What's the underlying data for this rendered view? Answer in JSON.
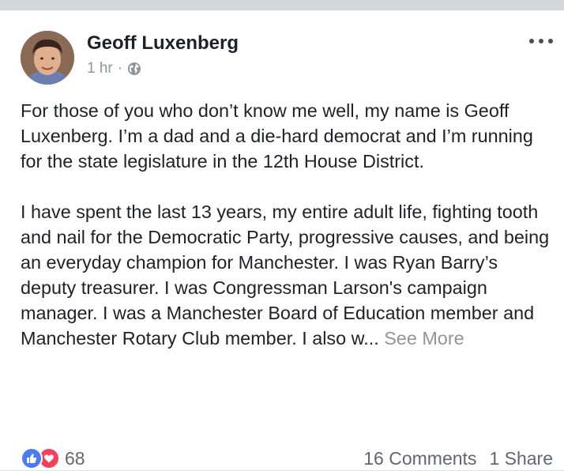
{
  "post": {
    "author": "Geoff Luxenberg",
    "time": "1 hr",
    "meta_separator": "·",
    "privacy_icon": "globe-icon",
    "paragraphs": [
      "For those of you who don’t know me well, my name is Geoff Luxenberg. I’m a dad and a die-hard democrat and I’m running for the state legislature in the 12th House District.",
      "I have spent the last 13 years, my entire adult life, fighting tooth and nail for the Democratic Party, progressive causes, and being an everyday champion for Manchester. I was Ryan Barry’s deputy treasurer. I was Congressman Larson's campaign manager. I was a Manchester Board of Education member and Manchester Rotary Club member. I also w..."
    ],
    "see_more": "See More"
  },
  "footer": {
    "reaction_count": "68",
    "comments": "16 Comments",
    "shares": "1 Share"
  },
  "colors": {
    "like": "#4a7cf6",
    "love": "#f2415d",
    "text": "#1d2129",
    "muted": "#90949c"
  }
}
